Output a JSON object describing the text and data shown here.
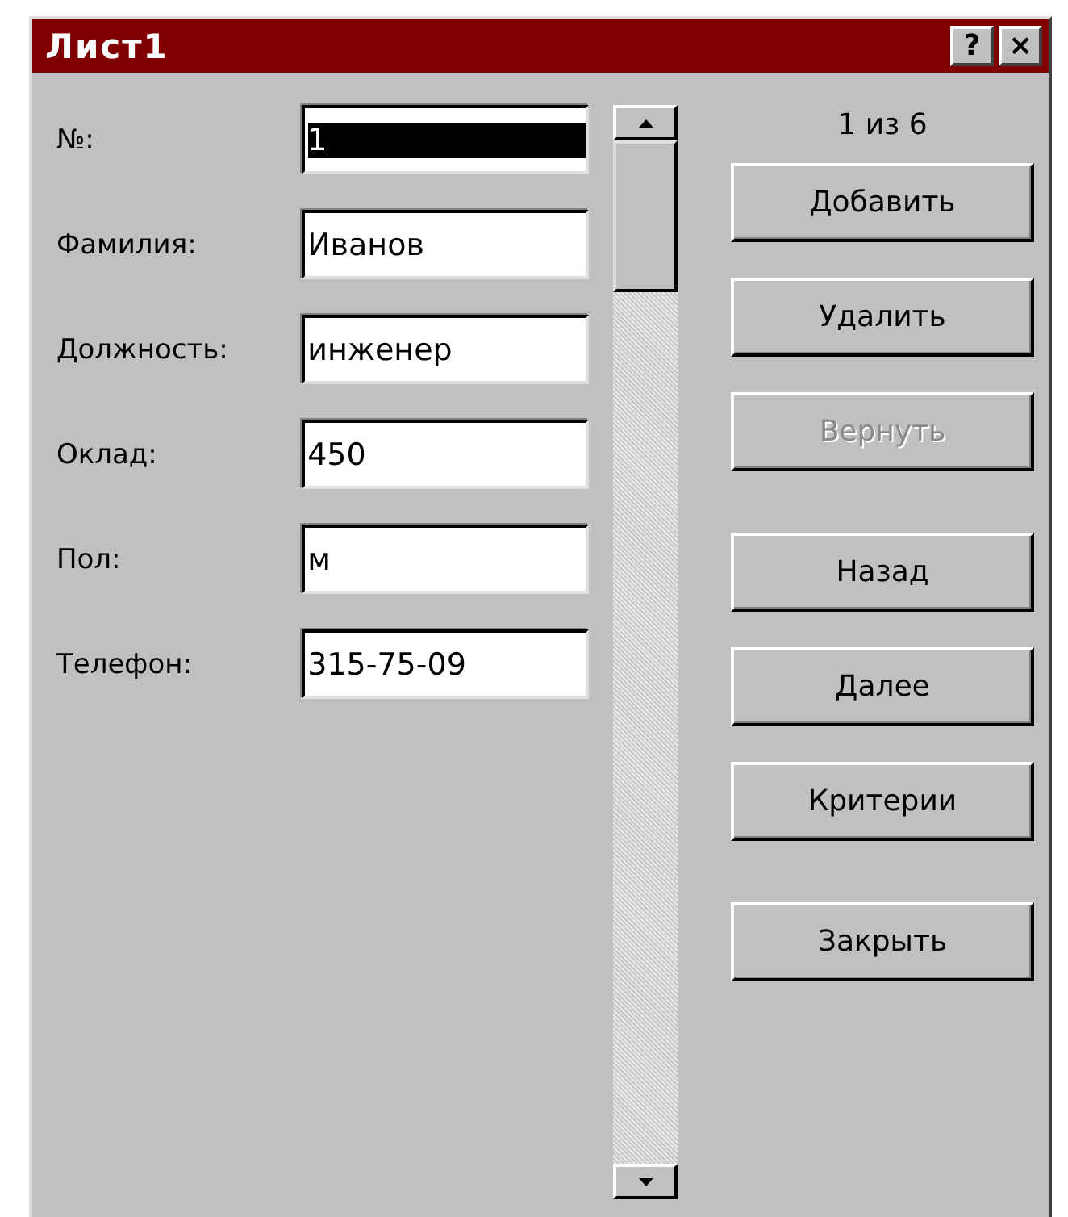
{
  "window": {
    "title": "Лист1",
    "title_buttons": [
      "?",
      "×"
    ]
  },
  "fields": [
    {
      "label": "№:",
      "value": "1",
      "focused": true
    },
    {
      "label": "Фамилия:",
      "value": "Иванов",
      "focused": false
    },
    {
      "label": "Должность:",
      "value": "инженер",
      "focused": false
    },
    {
      "label": "Оклад:",
      "value": "450",
      "focused": false
    },
    {
      "label": "Пол:",
      "value": "м",
      "focused": false
    },
    {
      "label": "Телефон:",
      "value": "315-75-09",
      "focused": false
    }
  ],
  "record_counter": "1 из 6",
  "button_groups": [
    [
      {
        "label": "Добавить",
        "disabled": false
      },
      {
        "label": "Удалить",
        "disabled": false
      },
      {
        "label": "Вернуть",
        "disabled": true
      }
    ],
    [
      {
        "label": "Назад",
        "disabled": false
      },
      {
        "label": "Далее",
        "disabled": false
      },
      {
        "label": "Критерии",
        "disabled": false
      }
    ],
    [
      {
        "label": "Закрыть",
        "disabled": false
      }
    ]
  ]
}
